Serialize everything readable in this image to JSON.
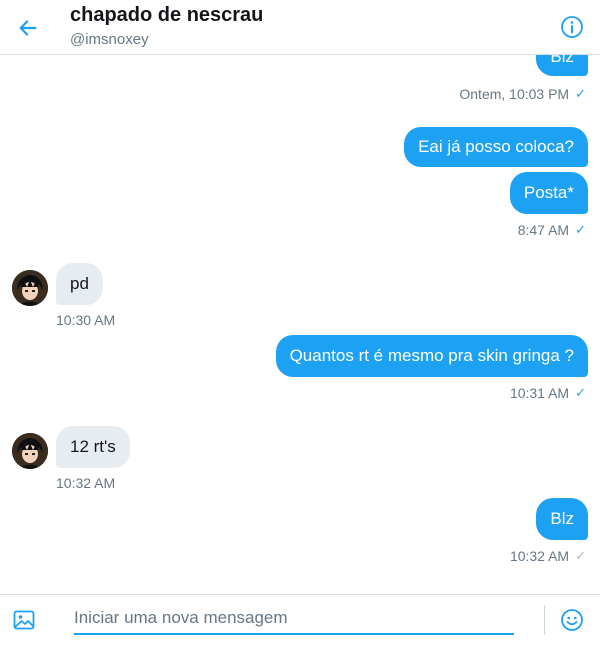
{
  "header": {
    "title": "chapado de nescrau",
    "handle": "@imsnoxey"
  },
  "messages": [
    {
      "type": "outgoing",
      "text": "Blz"
    },
    {
      "type": "meta",
      "time": "Ontem, 10:03 PM",
      "status": "read"
    },
    {
      "type": "outgoing",
      "text": "Eai já posso coloca?"
    },
    {
      "type": "outgoing",
      "text": "Posta*"
    },
    {
      "type": "meta",
      "time": "8:47 AM",
      "status": "read"
    },
    {
      "type": "incoming",
      "text": "pd"
    },
    {
      "type": "meta",
      "time": "10:30 AM"
    },
    {
      "type": "outgoing",
      "text": "Quantos rt é mesmo pra skin gringa ?"
    },
    {
      "type": "meta",
      "time": "10:31 AM",
      "status": "read"
    },
    {
      "type": "incoming",
      "text": "12 rt's"
    },
    {
      "type": "meta",
      "time": "10:32 AM"
    },
    {
      "type": "outgoing",
      "text": "Blz"
    },
    {
      "type": "meta",
      "time": "10:32 AM",
      "status": "sent"
    }
  ],
  "composer": {
    "placeholder": "Iniciar uma nova mensagem"
  },
  "colors": {
    "accent": "#1da1f2",
    "incoming_bubble": "#e6ecf0",
    "muted_text": "#657786"
  },
  "icons": [
    "back-arrow-icon",
    "info-icon",
    "image-icon",
    "emoji-icon",
    "checkmark-icon"
  ]
}
